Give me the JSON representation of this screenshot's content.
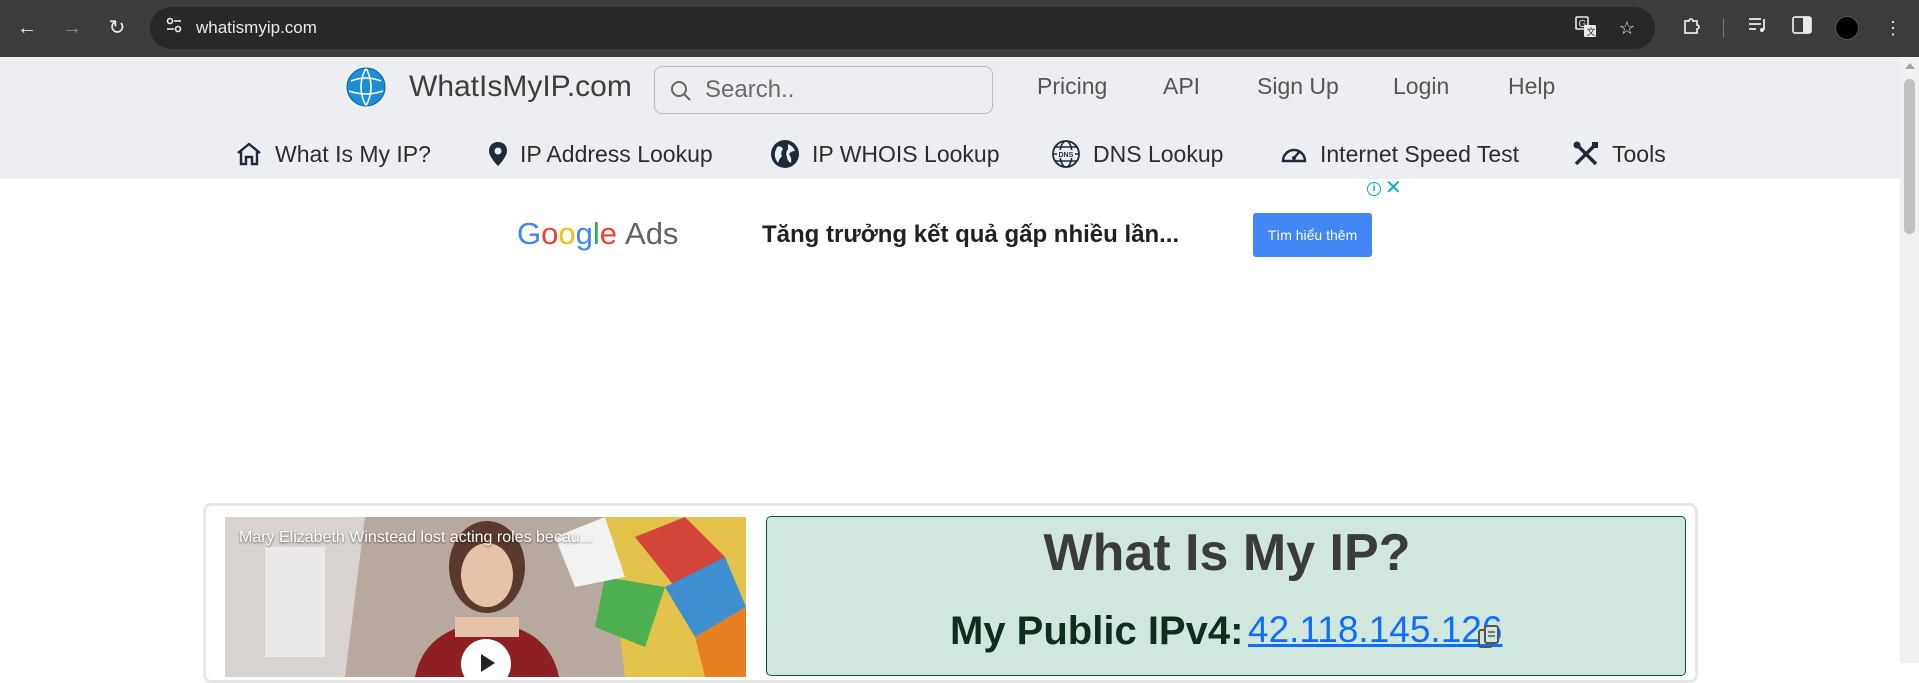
{
  "browser": {
    "url": "whatismyip.com",
    "icons": {
      "back": "back-arrow-icon",
      "forward": "forward-arrow-icon",
      "reload": "reload-icon",
      "site_info": "site-settings-icon",
      "translate": "translate-icon",
      "bookmark": "star-icon",
      "extensions": "puzzle-icon",
      "media": "media-queue-icon",
      "side_panel": "side-panel-icon",
      "menu": "kebab-menu-icon"
    }
  },
  "header": {
    "logo_text": "WhatIsMyIP.com",
    "search_placeholder": "Search..",
    "top_links": [
      "Pricing",
      "API",
      "Sign Up",
      "Login",
      "Help"
    ],
    "main_nav": [
      {
        "label": "What Is My IP?",
        "icon": "home-icon"
      },
      {
        "label": "IP Address Lookup",
        "icon": "map-pin-icon"
      },
      {
        "label": "IP WHOIS Lookup",
        "icon": "globe-icon"
      },
      {
        "label": "DNS Lookup",
        "icon": "dns-globe-icon"
      },
      {
        "label": "Internet Speed Test",
        "icon": "speedometer-icon"
      },
      {
        "label": "Tools",
        "icon": "tools-icon"
      }
    ]
  },
  "ad": {
    "brand_google": "Google",
    "brand_ads": "Ads",
    "text": "Tăng trưởng kết quả gấp nhiều lần...",
    "cta": "Tìm hiểu thêm"
  },
  "video": {
    "title": "Mary Elizabeth Winstead lost acting roles becau..."
  },
  "ip_panel": {
    "heading": "What Is My IP?",
    "ipv4_label": "My Public IPv4:",
    "ipv4_value": "42.118.145.126"
  },
  "colors": {
    "chrome_bg": "#3c3c3c",
    "header_bg": "#eceef2",
    "link_blue": "#0d6efd",
    "panel_green": "#d1e7dd",
    "ad_button": "#4285f4"
  }
}
